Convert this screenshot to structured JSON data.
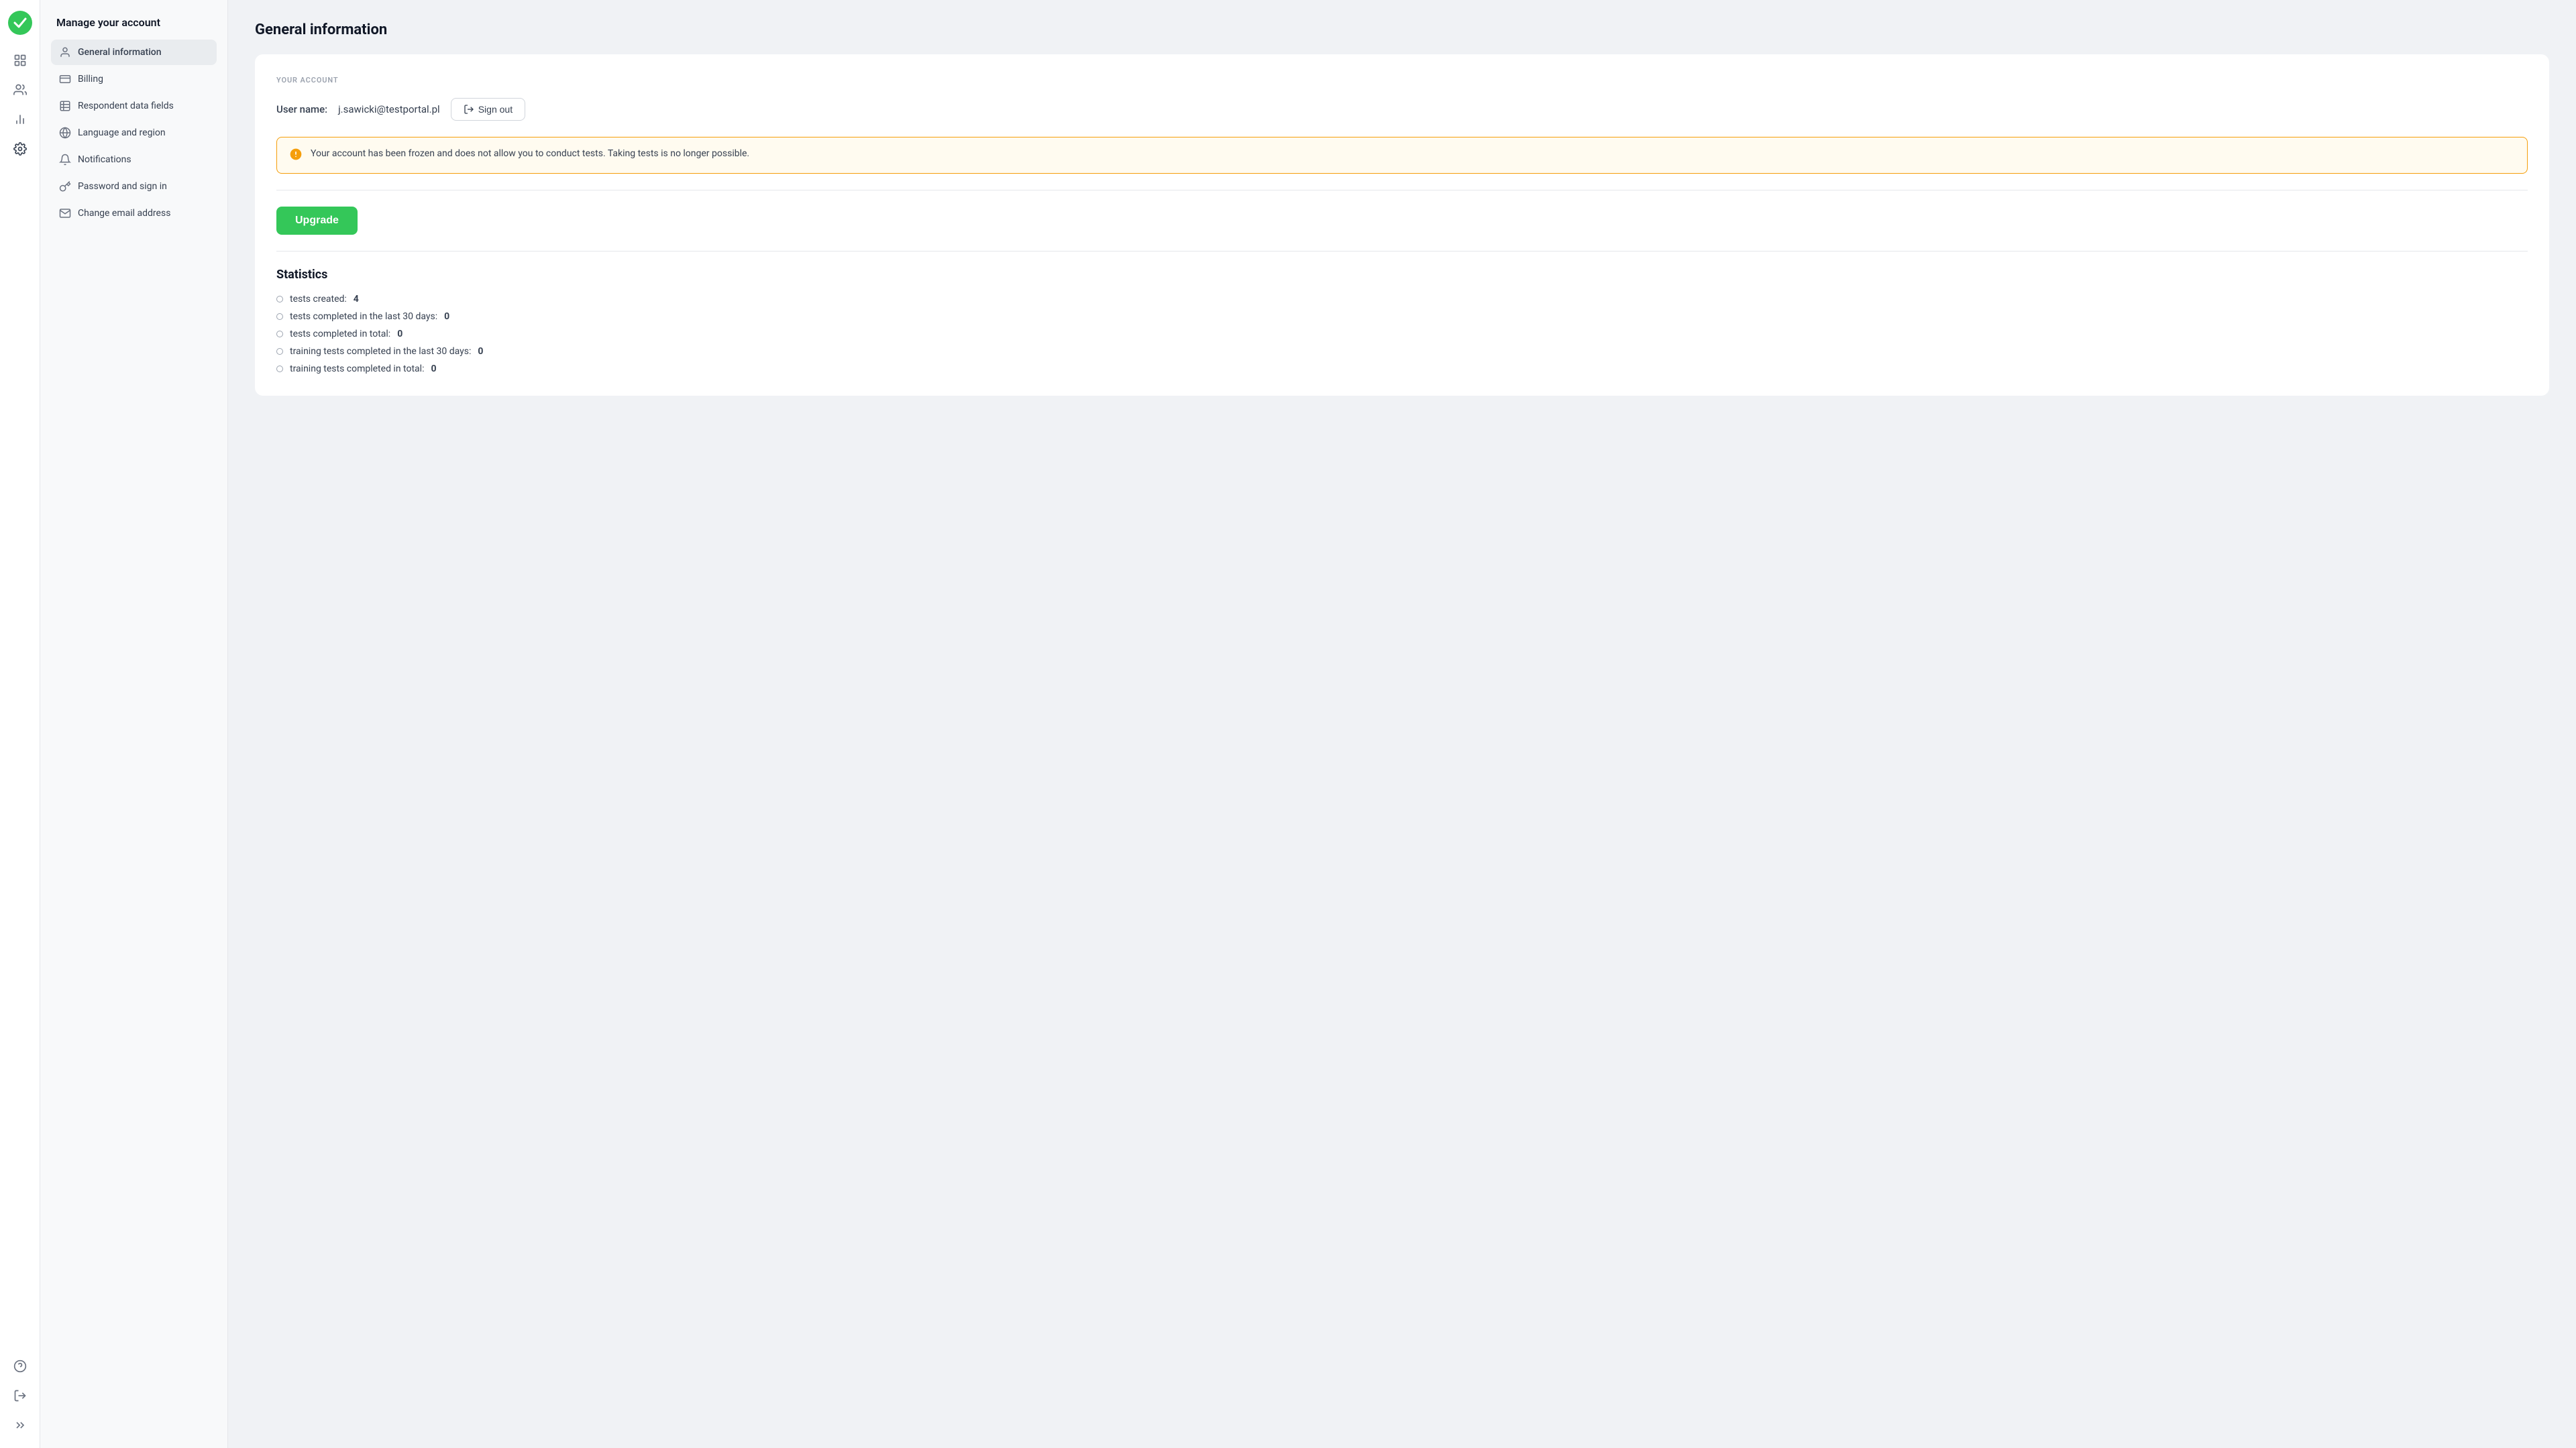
{
  "app": {
    "logo_alt": "TestPortal logo"
  },
  "icon_sidebar": {
    "icons": [
      {
        "name": "grid-icon",
        "label": "Dashboard",
        "symbol": "⊞",
        "active": false
      },
      {
        "name": "users-icon",
        "label": "Users",
        "symbol": "👥",
        "active": false
      },
      {
        "name": "chart-icon",
        "label": "Reports",
        "symbol": "📊",
        "active": false
      },
      {
        "name": "settings-icon",
        "label": "Settings",
        "symbol": "⚙",
        "active": true
      }
    ],
    "bottom_icons": [
      {
        "name": "help-icon",
        "label": "Help",
        "symbol": "?"
      },
      {
        "name": "signout-icon",
        "label": "Sign out",
        "symbol": "←"
      },
      {
        "name": "collapse-icon",
        "label": "Collapse",
        "symbol": ">>"
      }
    ]
  },
  "left_nav": {
    "title": "Manage your account",
    "items": [
      {
        "id": "general-information",
        "label": "General information",
        "active": true
      },
      {
        "id": "billing",
        "label": "Billing",
        "active": false
      },
      {
        "id": "respondent-data-fields",
        "label": "Respondent data fields",
        "active": false
      },
      {
        "id": "language-and-region",
        "label": "Language and region",
        "active": false
      },
      {
        "id": "notifications",
        "label": "Notifications",
        "active": false
      },
      {
        "id": "password-and-sign-in",
        "label": "Password and sign in",
        "active": false
      },
      {
        "id": "change-email-address",
        "label": "Change email address",
        "active": false
      }
    ]
  },
  "main": {
    "page_title": "General information",
    "your_account_label": "YOUR ACCOUNT",
    "username_label": "User name:",
    "username_value": "j.sawicki@testportal.pl",
    "signout_label": "Sign out",
    "warning_text": "Your account has been frozen and does not allow you to conduct tests. Taking tests is no longer possible.",
    "upgrade_label": "Upgrade",
    "statistics_title": "Statistics",
    "stats": [
      {
        "label": "tests created:",
        "value": "4",
        "bold": true
      },
      {
        "label": "tests completed in the last 30 days:",
        "value": "0",
        "bold": true
      },
      {
        "label": "tests completed in total:",
        "value": "0",
        "bold": true
      },
      {
        "label": "training tests completed in the last 30 days:",
        "value": "0",
        "bold": true
      },
      {
        "label": "training tests completed in total:",
        "value": "0",
        "bold": true
      }
    ]
  }
}
